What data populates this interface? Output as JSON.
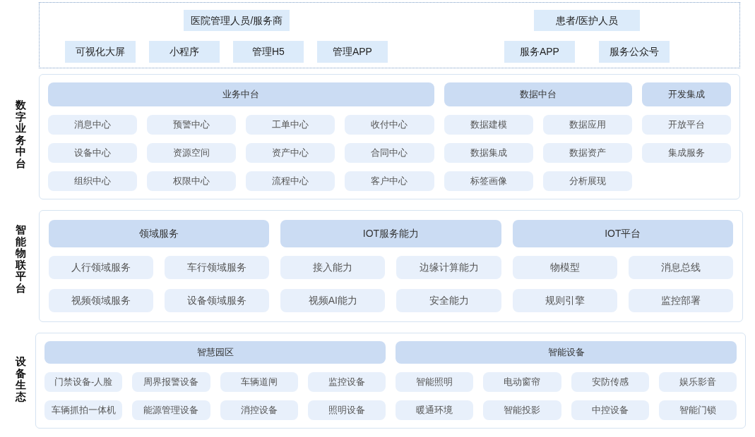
{
  "audiences": [
    {
      "title": "医院管理人员/服务商",
      "channels": [
        "可视化大屏",
        "小程序",
        "管理H5",
        "管理APP"
      ]
    },
    {
      "title": "患者/医护人员",
      "channels": [
        "服务APP",
        "服务公众号"
      ]
    }
  ],
  "layers": [
    {
      "label": "数字业务中台",
      "groups": [
        {
          "title": "业务中台",
          "items": [
            "消息中心",
            "预警中心",
            "工单中心",
            "收付中心",
            "设备中心",
            "资源空间",
            "资产中心",
            "合同中心",
            "组织中心",
            "权限中心",
            "流程中心",
            "客户中心"
          ]
        },
        {
          "title": "数据中台",
          "items": [
            "数据建模",
            "数据应用",
            "数据集成",
            "数据资产",
            "标签画像",
            "分析展现"
          ]
        },
        {
          "title": "开发集成",
          "items": [
            "开放平台",
            "集成服务"
          ]
        }
      ]
    },
    {
      "label": "智能物联平台",
      "groups": [
        {
          "title": "领域服务",
          "items": [
            "人行领域服务",
            "车行领域服务",
            "视频领域服务",
            "设备领域服务"
          ]
        },
        {
          "title": "IOT服务能力",
          "items": [
            "接入能力",
            "边缘计算能力",
            "视频AI能力",
            "安全能力"
          ]
        },
        {
          "title": "IOT平台",
          "items": [
            "物模型",
            "消息总线",
            "规则引擎",
            "监控部署"
          ]
        }
      ]
    },
    {
      "label": "设备生态",
      "groups": [
        {
          "title": "智慧园区",
          "items": [
            "门禁设备-人脸",
            "周界报警设备",
            "车辆道闸",
            "监控设备",
            "车辆抓拍一体机",
            "能源管理设备",
            "消控设备",
            "照明设备"
          ]
        },
        {
          "title": "智能设备",
          "items": [
            "智能照明",
            "电动窗帘",
            "安防传感",
            "娱乐影音",
            "暖通环境",
            "智能投影",
            "中控设备",
            "智能门锁"
          ]
        }
      ]
    }
  ]
}
